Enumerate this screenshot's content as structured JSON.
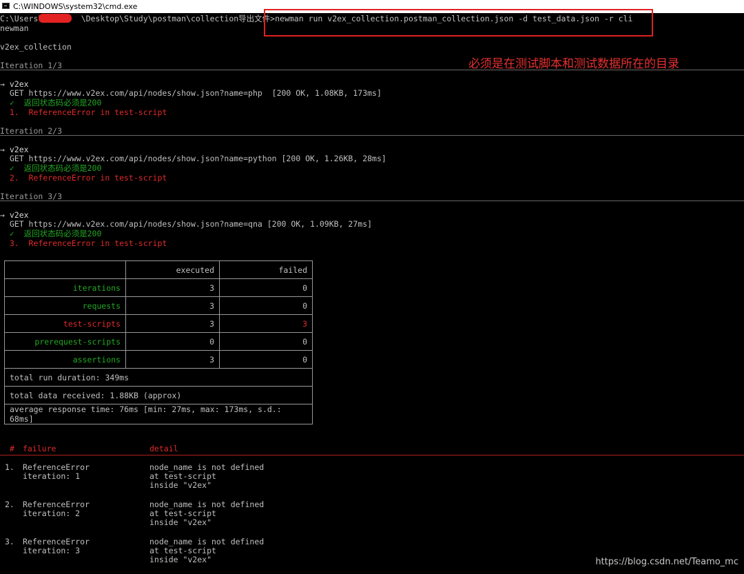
{
  "window": {
    "title": "C:\\WINDOWS\\system32\\cmd.exe"
  },
  "prompt": {
    "path": "C:\\Users\\        \\Desktop\\Study\\postman\\collection导出文件>",
    "command": "newman run v2ex_collection.postman_collection.json -d test_data.json -r cli"
  },
  "output": {
    "tool": "newman",
    "collection": "v2ex_collection",
    "iterations": [
      {
        "header": "Iteration 1/3",
        "request_name": "→ v2ex",
        "request_line": "  GET https://www.v2ex.com/api/nodes/show.json?name=php  [200 OK, 1.08KB, 173ms]",
        "pass_line": "  ✓  返回状态码必须是200",
        "fail_line": "  1.  ReferenceError in test-script"
      },
      {
        "header": "Iteration 2/3",
        "request_name": "→ v2ex",
        "request_line": "  GET https://www.v2ex.com/api/nodes/show.json?name=python [200 OK, 1.26KB, 28ms]",
        "pass_line": "  ✓  返回状态码必须是200",
        "fail_line": "  2.  ReferenceError in test-script"
      },
      {
        "header": "Iteration 3/3",
        "request_name": "→ v2ex",
        "request_line": "  GET https://www.v2ex.com/api/nodes/show.json?name=qna [200 OK, 1.09KB, 27ms]",
        "pass_line": "  ✓  返回状态码必须是200",
        "fail_line": "  3.  ReferenceError in test-script"
      }
    ]
  },
  "summary": {
    "col_executed": "executed",
    "col_failed": "failed",
    "rows": [
      {
        "label": "iterations",
        "executed": "3",
        "failed": "0"
      },
      {
        "label": "requests",
        "executed": "3",
        "failed": "0"
      },
      {
        "label": "test-scripts",
        "executed": "3",
        "failed": "3"
      },
      {
        "label": "prerequest-scripts",
        "executed": "0",
        "failed": "0"
      },
      {
        "label": "assertions",
        "executed": "3",
        "failed": "0"
      }
    ],
    "total_run_duration": "total run duration: 349ms",
    "total_data_received": "total data received: 1.88KB (approx)",
    "average_response_time": "average response time: 76ms [min: 27ms, max: 173ms, s.d.: 68ms]"
  },
  "failures": {
    "col_num": "#",
    "col_failure": "failure",
    "col_detail": "detail",
    "items": [
      {
        "num": "1.",
        "type": "ReferenceError",
        "iteration": "iteration: 1",
        "detail1": "node_name is not defined",
        "detail2": "at test-script",
        "detail3": "inside \"v2ex\""
      },
      {
        "num": "2.",
        "type": "ReferenceError",
        "iteration": "iteration: 2",
        "detail1": "node_name is not defined",
        "detail2": "at test-script",
        "detail3": "inside \"v2ex\""
      },
      {
        "num": "3.",
        "type": "ReferenceError",
        "iteration": "iteration: 3",
        "detail1": "node_name is not defined",
        "detail2": "at test-script",
        "detail3": "inside \"v2ex\""
      }
    ]
  },
  "annotation": {
    "text": "必须是在测试脚本和测试数据所在的目录"
  },
  "watermark": "https://blog.csdn.net/Teamo_mc",
  "colors": {
    "pass_green": "#22a822",
    "fail_red": "#e02a2a",
    "annotation_red": "#e02020"
  }
}
